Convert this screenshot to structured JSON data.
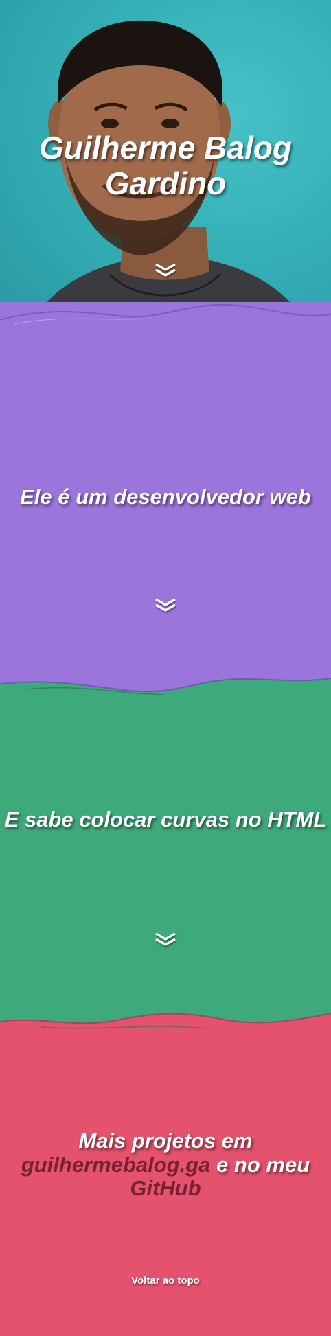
{
  "hero": {
    "title": "Guilherme Balog Gardino"
  },
  "section2": {
    "text": "Ele é um desenvolvedor web"
  },
  "section3": {
    "text": "E sabe colocar curvas no HTML"
  },
  "section4": {
    "text_before": "Mais projetos em",
    "link1": "guilhermebalog.ga",
    "text_middle": "e no meu",
    "link2": "GitHub"
  },
  "footer": {
    "back_to_top": "Voltar ao topo"
  },
  "colors": {
    "hero_bg": "#35b0b7",
    "purple": "#9c75dc",
    "green": "#3ea97c",
    "pink": "#e5526e",
    "link": "#7a2034"
  },
  "icons": [
    "chevron-down-icon"
  ]
}
